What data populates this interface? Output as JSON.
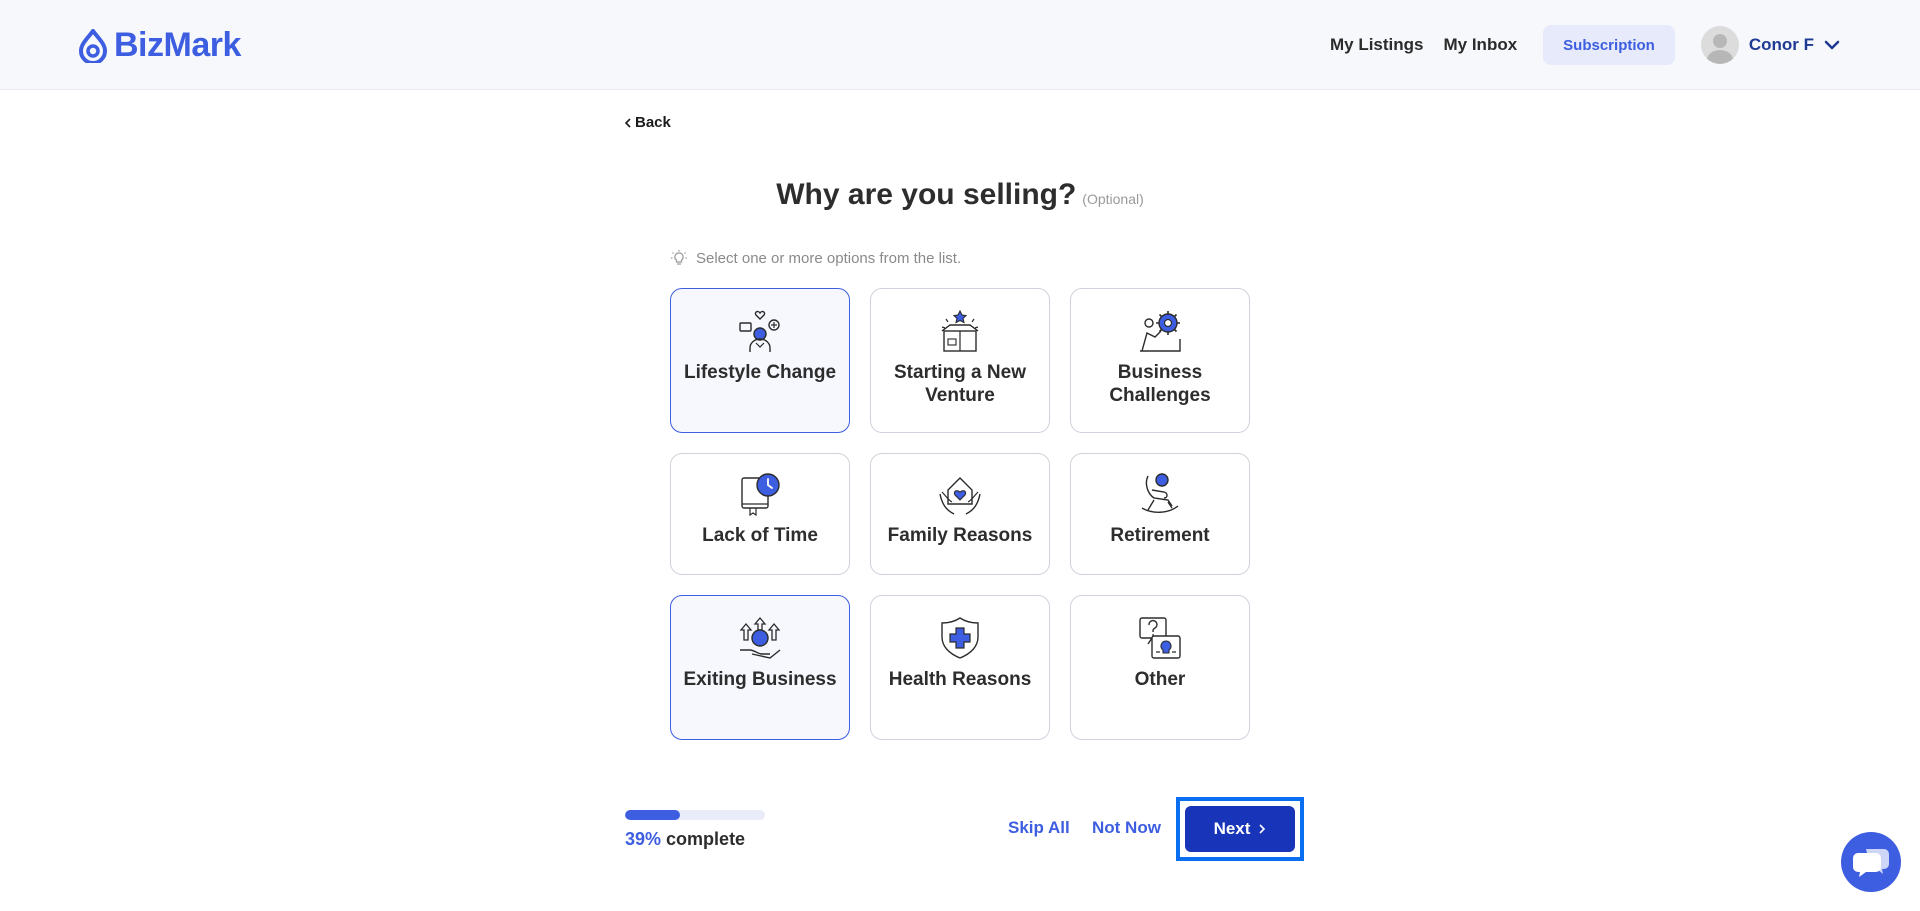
{
  "brand": {
    "name": "BizMark",
    "color": "#3d5ee0"
  },
  "nav": {
    "my_listings": "My Listings",
    "my_inbox": "My Inbox",
    "subscription": "Subscription",
    "user_name": "Conor F"
  },
  "back_label": "Back",
  "question": {
    "title": "Why are you selling?",
    "optional": "(Optional)"
  },
  "hint": "Select one or more options from the list.",
  "options": [
    {
      "label": "Lifestyle Change",
      "selected": true,
      "icon": "lifestyle-icon"
    },
    {
      "label": "Starting a New Venture",
      "selected": false,
      "icon": "gift-box-icon"
    },
    {
      "label": "Business Challenges",
      "selected": false,
      "icon": "gear-person-icon"
    },
    {
      "label": "Lack of Time",
      "selected": false,
      "icon": "clock-book-icon"
    },
    {
      "label": "Family Reasons",
      "selected": false,
      "icon": "family-hands-icon"
    },
    {
      "label": "Retirement",
      "selected": false,
      "icon": "rocking-chair-icon"
    },
    {
      "label": "Exiting Business",
      "selected": true,
      "icon": "coin-hand-icon"
    },
    {
      "label": "Health Reasons",
      "selected": false,
      "icon": "health-shield-icon"
    },
    {
      "label": "Other",
      "selected": false,
      "icon": "question-icon"
    }
  ],
  "progress": {
    "percent": "39%",
    "suffix": "complete",
    "fraction": 0.39
  },
  "actions": {
    "skip_all": "Skip All",
    "not_now": "Not Now",
    "next": "Next"
  }
}
